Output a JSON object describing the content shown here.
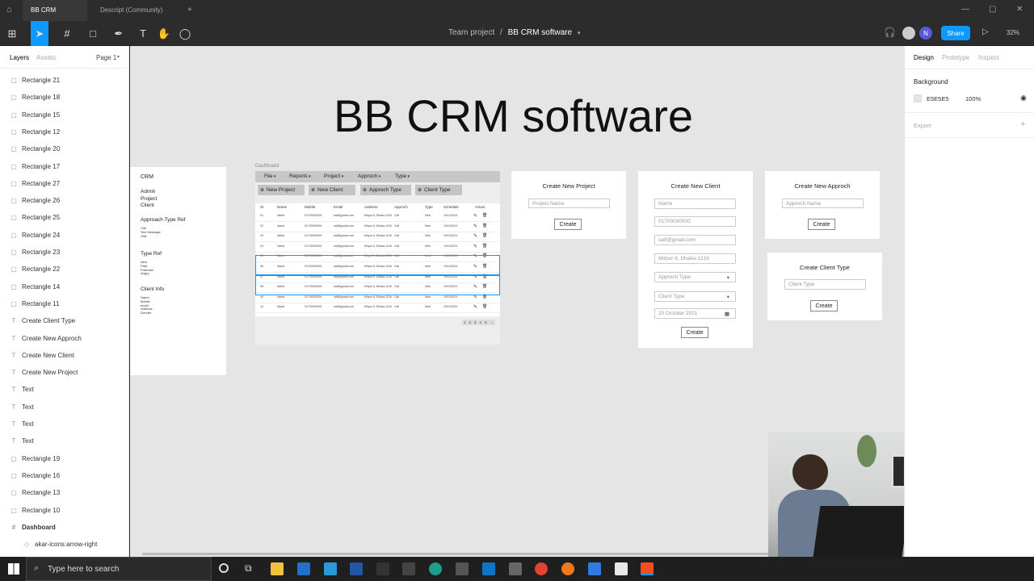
{
  "tabs": [
    "BB CRM software",
    "Descript (Community)"
  ],
  "new_tab": "+",
  "breadcrumb": {
    "team": "Team project",
    "sep": "/",
    "file": "BB CRM software"
  },
  "share_label": "Share",
  "zoom": "32%",
  "avatars": [
    "",
    "N"
  ],
  "left_panel": {
    "tabs": [
      "Layers",
      "Assets"
    ],
    "page": "Page 1",
    "layers": [
      {
        "icon": "rect",
        "label": "Rectangle 21"
      },
      {
        "icon": "rect",
        "label": "Rectangle 18"
      },
      {
        "icon": "rect",
        "label": "Rectangle 15"
      },
      {
        "icon": "rect",
        "label": "Rectangle 12"
      },
      {
        "icon": "rect",
        "label": "Rectangle 20"
      },
      {
        "icon": "rect",
        "label": "Rectangle 17"
      },
      {
        "icon": "rect",
        "label": "Rectangle 27"
      },
      {
        "icon": "rect",
        "label": "Rectangle 26"
      },
      {
        "icon": "rect",
        "label": "Rectangle 25"
      },
      {
        "icon": "rect",
        "label": "Rectangle 24"
      },
      {
        "icon": "rect",
        "label": "Rectangle 23"
      },
      {
        "icon": "rect",
        "label": "Rectangle 22"
      },
      {
        "icon": "rect",
        "label": "Rectangle 14"
      },
      {
        "icon": "rect",
        "label": "Rectangle 11"
      },
      {
        "icon": "text",
        "label": "Create Client Type"
      },
      {
        "icon": "text",
        "label": "Create New Approch"
      },
      {
        "icon": "text",
        "label": "Create New Client"
      },
      {
        "icon": "text",
        "label": "Create New Project"
      },
      {
        "icon": "text",
        "label": "Text"
      },
      {
        "icon": "text",
        "label": "Text"
      },
      {
        "icon": "text",
        "label": "Text"
      },
      {
        "icon": "text",
        "label": "Text"
      },
      {
        "icon": "rect",
        "label": "Rectangle 19"
      },
      {
        "icon": "rect",
        "label": "Rectangle 16"
      },
      {
        "icon": "rect",
        "label": "Rectangle 13"
      },
      {
        "icon": "rect",
        "label": "Rectangle 10"
      },
      {
        "icon": "frame",
        "label": "Dashboard"
      },
      {
        "icon": "component",
        "label": "akar-icons:arrow-right",
        "child": true
      }
    ]
  },
  "right_panel": {
    "tabs": [
      "Design",
      "Prototype",
      "Inspect"
    ],
    "background_label": "Background",
    "bg_hex": "E5E5E5",
    "bg_opacity": "100%",
    "export_label": "Export",
    "add": "+"
  },
  "canvas": {
    "title": "BB CRM software",
    "sidebar": {
      "crm": "CRM",
      "groups": [
        {
          "title": "",
          "items": [
            "Admin",
            "Project",
            "Client"
          ]
        },
        {
          "title": "Approach Type Ref",
          "items": [
            "Call",
            "Text Message",
            "Visit"
          ]
        },
        {
          "title": "Type Ref",
          "items": [
            "New",
            "Paid",
            "Potential",
            "Angry"
          ]
        },
        {
          "title": "Client Info",
          "items": [
            "Name",
            "Mobile",
            "email",
            "Address",
            "Gender"
          ]
        }
      ]
    },
    "dashboard": {
      "label": "Dashboard",
      "menu": [
        "File",
        "Reports",
        "Project",
        "Approch",
        "Type"
      ],
      "buttons": [
        "New Project",
        "New Client",
        "Approch Type",
        "Client Type"
      ],
      "columns": [
        "Sl",
        "Name",
        "Mobile",
        "Email",
        "Address",
        "Approch",
        "Type",
        "Schedule",
        "Action"
      ],
      "rows": [
        [
          "01",
          "Name",
          "01700000000",
          "saif@gmail.com",
          "Mirpur 6, Dhaka-1216",
          "Call",
          "New",
          "19/10/2021"
        ],
        [
          "02",
          "Name",
          "01700000000",
          "saif@gmail.com",
          "Mirpur 6, Dhaka-1216",
          "Call",
          "New",
          "19/10/2021"
        ],
        [
          "03",
          "Name",
          "01700000000",
          "saif@gmail.com",
          "Mirpur 6, Dhaka-1216",
          "Call",
          "New",
          "19/10/2021"
        ],
        [
          "04",
          "Name",
          "01700000000",
          "saif@gmail.com",
          "Mirpur 6, Dhaka-1216",
          "Call",
          "New",
          "19/10/2021"
        ],
        [
          "05",
          "Name",
          "01700000000",
          "saif@gmail.com",
          "Mirpur 6, Dhaka-1216",
          "Call",
          "New",
          "19/10/2021"
        ],
        [
          "06",
          "Name",
          "01700000000",
          "saif@gmail.com",
          "Mirpur 6, Dhaka-1216",
          "Call",
          "New",
          "19/10/2021"
        ],
        [
          "07",
          "Name",
          "01700000000",
          "saif@gmail.com",
          "Mirpur 6, Dhaka-1216",
          "Call",
          "New",
          "19/10/2021"
        ],
        [
          "08",
          "Name",
          "01700000000",
          "saif@gmail.com",
          "Mirpur 6, Dhaka-1216",
          "Call",
          "New",
          "19/10/2021"
        ],
        [
          "09",
          "Name",
          "01700000000",
          "saif@gmail.com",
          "Mirpur 6, Dhaka-1216",
          "Call",
          "New",
          "19/10/2021"
        ],
        [
          "10",
          "Name",
          "01700000000",
          "saif@gmail.com",
          "Mirpur 6, Dhaka-1216",
          "Call",
          "New",
          "19/10/2021"
        ]
      ],
      "pagination": [
        "1",
        "2",
        "3",
        "4",
        "5",
        "→"
      ]
    },
    "create_project": {
      "title": "Create New Project",
      "placeholder": "Project Name",
      "button": "Create"
    },
    "create_client": {
      "title": "Create New Client",
      "fields": [
        "Name",
        "01700000000",
        "saif@gmail.com",
        "Mirpur 6, Dhaka-1216"
      ],
      "approach_select": "Approch Type",
      "client_select": "Client Type",
      "date": "20 October 2021",
      "button": "Create"
    },
    "create_approach": {
      "title": "Create New Approch",
      "placeholder": "Approch Name",
      "button": "Create"
    },
    "create_client_type": {
      "title": "Create Client Type",
      "placeholder": "Client Type",
      "button": "Create"
    }
  },
  "taskbar": {
    "search_placeholder": "Type here to search"
  },
  "colors": {
    "accent": "#0d99ff",
    "canvas_bg": "#e5e5e5",
    "chrome": "#2c2c2c"
  }
}
